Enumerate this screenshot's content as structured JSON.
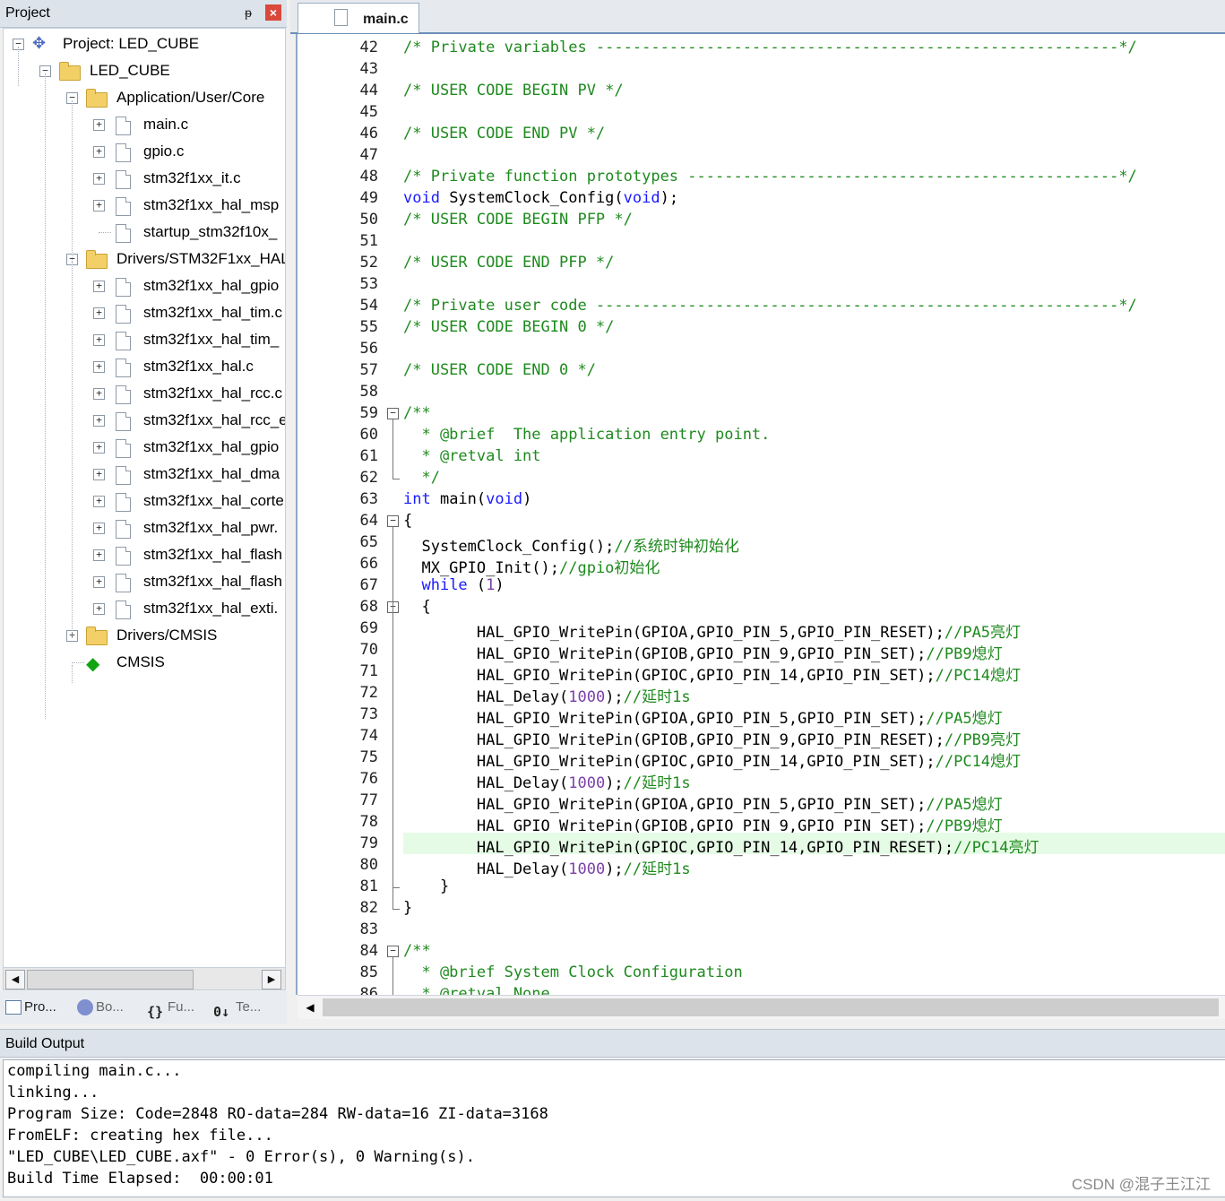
{
  "project_pane": {
    "title": "Project",
    "pin_glyph": "ᵽ",
    "close_glyph": "×",
    "tree": [
      {
        "label": "Project: LED_CUBE",
        "icon": "project-icon",
        "expander": "−"
      },
      {
        "label": "LED_CUBE",
        "icon": "target-icon",
        "expander": "−"
      },
      {
        "label": "Application/User/Core",
        "icon": "folder-icon",
        "expander": "−"
      },
      {
        "label": "main.c",
        "icon": "file-icon",
        "expander": "+"
      },
      {
        "label": "gpio.c",
        "icon": "file-icon",
        "expander": "+"
      },
      {
        "label": "stm32f1xx_it.c",
        "icon": "file-icon",
        "expander": "+"
      },
      {
        "label": "stm32f1xx_hal_msp",
        "icon": "file-icon",
        "expander": "+"
      },
      {
        "label": "startup_stm32f10x_",
        "icon": "file-icon",
        "expander": ""
      },
      {
        "label": "Drivers/STM32F1xx_HAL",
        "icon": "folder-icon",
        "expander": "−"
      },
      {
        "label": "stm32f1xx_hal_gpio",
        "icon": "file-icon",
        "expander": "+"
      },
      {
        "label": "stm32f1xx_hal_tim.c",
        "icon": "file-icon",
        "expander": "+"
      },
      {
        "label": "stm32f1xx_hal_tim_",
        "icon": "file-icon",
        "expander": "+"
      },
      {
        "label": "stm32f1xx_hal.c",
        "icon": "file-icon",
        "expander": "+"
      },
      {
        "label": "stm32f1xx_hal_rcc.c",
        "icon": "file-icon",
        "expander": "+"
      },
      {
        "label": "stm32f1xx_hal_rcc_e",
        "icon": "file-icon",
        "expander": "+"
      },
      {
        "label": "stm32f1xx_hal_gpio",
        "icon": "file-icon",
        "expander": "+"
      },
      {
        "label": "stm32f1xx_hal_dma",
        "icon": "file-icon",
        "expander": "+"
      },
      {
        "label": "stm32f1xx_hal_corte",
        "icon": "file-icon",
        "expander": "+"
      },
      {
        "label": "stm32f1xx_hal_pwr.",
        "icon": "file-icon",
        "expander": "+"
      },
      {
        "label": "stm32f1xx_hal_flash",
        "icon": "file-icon",
        "expander": "+"
      },
      {
        "label": "stm32f1xx_hal_flash",
        "icon": "file-icon",
        "expander": "+"
      },
      {
        "label": "stm32f1xx_hal_exti.",
        "icon": "file-icon",
        "expander": "+"
      },
      {
        "label": "Drivers/CMSIS",
        "icon": "folder-icon",
        "expander": "+"
      },
      {
        "label": "CMSIS",
        "icon": "cmsis-diamond-icon",
        "expander": ""
      }
    ],
    "bottom_tabs": [
      {
        "label": "Pro...",
        "icon": "project-tab-icon"
      },
      {
        "label": "Bo...",
        "icon": "books-tab-icon"
      },
      {
        "label": "Fu...",
        "icon": "functions-tab-icon"
      },
      {
        "label": "Te...",
        "icon": "templates-tab-icon"
      }
    ]
  },
  "editor": {
    "tab_label": "main.c",
    "lines": [
      {
        "n": "42",
        "text": "/* Private variables ---------------------------------------------------------*/"
      },
      {
        "n": "43",
        "text": ""
      },
      {
        "n": "44",
        "text": "/* USER CODE BEGIN PV */"
      },
      {
        "n": "45",
        "text": ""
      },
      {
        "n": "46",
        "text": "/* USER CODE END PV */"
      },
      {
        "n": "47",
        "text": ""
      },
      {
        "n": "48",
        "text": "/* Private function prototypes -----------------------------------------------*/"
      },
      {
        "n": "49",
        "text": "void SystemClock_Config(void);"
      },
      {
        "n": "50",
        "text": "/* USER CODE BEGIN PFP */"
      },
      {
        "n": "51",
        "text": ""
      },
      {
        "n": "52",
        "text": "/* USER CODE END PFP */"
      },
      {
        "n": "53",
        "text": ""
      },
      {
        "n": "54",
        "text": "/* Private user code ---------------------------------------------------------*/"
      },
      {
        "n": "55",
        "text": "/* USER CODE BEGIN 0 */"
      },
      {
        "n": "56",
        "text": ""
      },
      {
        "n": "57",
        "text": "/* USER CODE END 0 */"
      },
      {
        "n": "58",
        "text": ""
      },
      {
        "n": "59",
        "text": "/**"
      },
      {
        "n": "60",
        "text": "  * @brief  The application entry point."
      },
      {
        "n": "61",
        "text": "  * @retval int"
      },
      {
        "n": "62",
        "text": "  */"
      },
      {
        "n": "63",
        "text": "int main(void)"
      },
      {
        "n": "64",
        "text": "{"
      },
      {
        "n": "65",
        "text": "  SystemClock_Config();//系统时钟初始化"
      },
      {
        "n": "66",
        "text": "  MX_GPIO_Init();//gpio初始化"
      },
      {
        "n": "67",
        "text": "  while (1)"
      },
      {
        "n": "68",
        "text": "  {"
      },
      {
        "n": "69",
        "text": "        HAL_GPIO_WritePin(GPIOA,GPIO_PIN_5,GPIO_PIN_RESET);//PA5亮灯"
      },
      {
        "n": "70",
        "text": "        HAL_GPIO_WritePin(GPIOB,GPIO_PIN_9,GPIO_PIN_SET);//PB9熄灯"
      },
      {
        "n": "71",
        "text": "        HAL_GPIO_WritePin(GPIOC,GPIO_PIN_14,GPIO_PIN_SET);//PC14熄灯"
      },
      {
        "n": "72",
        "text": "        HAL_Delay(1000);//延时1s"
      },
      {
        "n": "73",
        "text": "        HAL_GPIO_WritePin(GPIOA,GPIO_PIN_5,GPIO_PIN_SET);//PA5熄灯"
      },
      {
        "n": "74",
        "text": "        HAL_GPIO_WritePin(GPIOB,GPIO_PIN_9,GPIO_PIN_RESET);//PB9亮灯"
      },
      {
        "n": "75",
        "text": "        HAL_GPIO_WritePin(GPIOC,GPIO_PIN_14,GPIO_PIN_SET);//PC14熄灯"
      },
      {
        "n": "76",
        "text": "        HAL_Delay(1000);//延时1s"
      },
      {
        "n": "77",
        "text": "        HAL_GPIO_WritePin(GPIOA,GPIO_PIN_5,GPIO_PIN_SET);//PA5熄灯"
      },
      {
        "n": "78",
        "text": "        HAL_GPIO_WritePin(GPIOB,GPIO_PIN_9,GPIO_PIN_SET);//PB9熄灯"
      },
      {
        "n": "79",
        "text": "        HAL_GPIO_WritePin(GPIOC,GPIO_PIN_14,GPIO_PIN_RESET);//PC14亮灯",
        "highlight": true
      },
      {
        "n": "80",
        "text": "        HAL_Delay(1000);//延时1s"
      },
      {
        "n": "81",
        "text": "    }"
      },
      {
        "n": "82",
        "text": "}"
      },
      {
        "n": "83",
        "text": ""
      },
      {
        "n": "84",
        "text": "/**"
      },
      {
        "n": "85",
        "text": "  * @brief System Clock Configuration"
      },
      {
        "n": "86",
        "text": "  * @retval None"
      }
    ]
  },
  "build_output": {
    "title": "Build Output",
    "lines": [
      "compiling main.c...",
      "linking...",
      "Program Size: Code=2848 RO-data=284 RW-data=16 ZI-data=3168",
      "FromELF: creating hex file...",
      "\"LED_CUBE\\LED_CUBE.axf\" - 0 Error(s), 0 Warning(s).",
      "Build Time Elapsed:  00:00:01"
    ]
  },
  "watermark": "CSDN @混子王江江"
}
